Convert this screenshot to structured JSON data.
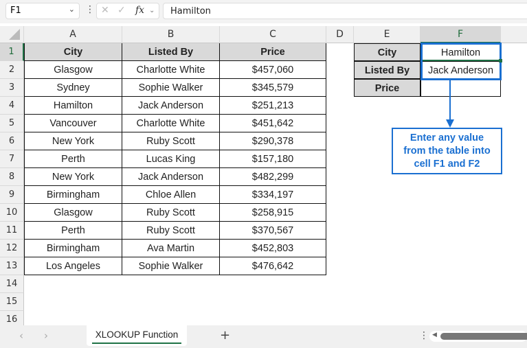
{
  "formula_bar": {
    "name_box": "F1",
    "formula": "Hamilton",
    "fx": "fx"
  },
  "columns": [
    "A",
    "B",
    "C",
    "D",
    "E",
    "F"
  ],
  "rows": [
    "1",
    "2",
    "3",
    "4",
    "5",
    "6",
    "7",
    "8",
    "9",
    "10",
    "11",
    "12",
    "13",
    "14",
    "15",
    "16"
  ],
  "table": {
    "headers": [
      "City",
      "Listed By",
      "Price"
    ],
    "rows": [
      [
        "Glasgow",
        "Charlotte White",
        "$457,060"
      ],
      [
        "Sydney",
        "Sophie Walker",
        "$345,579"
      ],
      [
        "Hamilton",
        "Jack Anderson",
        "$251,213"
      ],
      [
        "Vancouver",
        "Charlotte White",
        "$451,642"
      ],
      [
        "New York",
        "Ruby Scott",
        "$290,378"
      ],
      [
        "Perth",
        "Lucas King",
        "$157,180"
      ],
      [
        "New York",
        "Jack Anderson",
        "$482,299"
      ],
      [
        "Birmingham",
        "Chloe Allen",
        "$334,197"
      ],
      [
        "Glasgow",
        "Ruby Scott",
        "$258,915"
      ],
      [
        "Perth",
        "Ruby Scott",
        "$370,567"
      ],
      [
        "Birmingham",
        "Ava Martin",
        "$452,803"
      ],
      [
        "Los Angeles",
        "Sophie Walker",
        "$476,642"
      ]
    ]
  },
  "lookup": {
    "labels": [
      "City",
      "Listed By",
      "Price"
    ],
    "values": [
      "Hamilton",
      "Jack Anderson",
      ""
    ]
  },
  "callout": {
    "line1": "Enter any value",
    "line2": "from the table into",
    "line3": "cell F1 and F2"
  },
  "sheet_tabs": {
    "active": "XLOOKUP Function",
    "add": "+"
  }
}
